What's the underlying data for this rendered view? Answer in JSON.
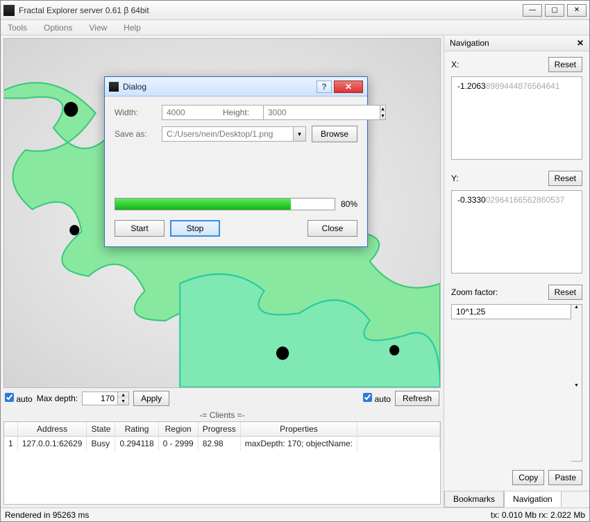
{
  "window": {
    "title": "Fractal Explorer server  0.61 β 64bit"
  },
  "menu": {
    "tools": "Tools",
    "options": "Options",
    "view": "View",
    "help": "Help"
  },
  "depth": {
    "auto1": "auto",
    "maxdepth_lbl": "Max depth:",
    "maxdepth_val": "170",
    "apply": "Apply",
    "auto2": "auto",
    "refresh": "Refresh"
  },
  "clients": {
    "title": "-= Clients =-",
    "headers": {
      "idx": "",
      "addr": "Address",
      "state": "State",
      "rating": "Rating",
      "region": "Region",
      "progress": "Progress",
      "props": "Properties"
    },
    "row": {
      "idx": "1",
      "addr": "127.0.0.1:62629",
      "state": "Busy",
      "rating": "0.294118",
      "region": "0 - 2999",
      "progress": "82.98",
      "props": "maxDepth: 170; objectName:"
    }
  },
  "nav": {
    "title": "Navigation",
    "x_lbl": "X:",
    "reset": "Reset",
    "x_val_dark": "-1.2063",
    "x_val_gray": "8989444876564641",
    "y_lbl": "Y:",
    "y_val_dark": "-0.3330",
    "y_val_gray": "02964166562860537",
    "zoom_lbl": "Zoom factor:",
    "zoom_val": "10^1,25",
    "copy": "Copy",
    "paste": "Paste",
    "tab_bookmarks": "Bookmarks",
    "tab_nav": "Navigation"
  },
  "status": {
    "left": "Rendered in 95263 ms",
    "right": "tx: 0.010 Mb rx: 2.022 Mb"
  },
  "dialog": {
    "title": "Dialog",
    "width_lbl": "Width:",
    "width_val": "4000",
    "height_lbl": "Height:",
    "height_val": "3000",
    "saveas_lbl": "Save as:",
    "path": "C:/Users/nein/Desktop/1.png",
    "browse": "Browse",
    "percent": "80%",
    "start": "Start",
    "stop": "Stop",
    "close": "Close"
  }
}
